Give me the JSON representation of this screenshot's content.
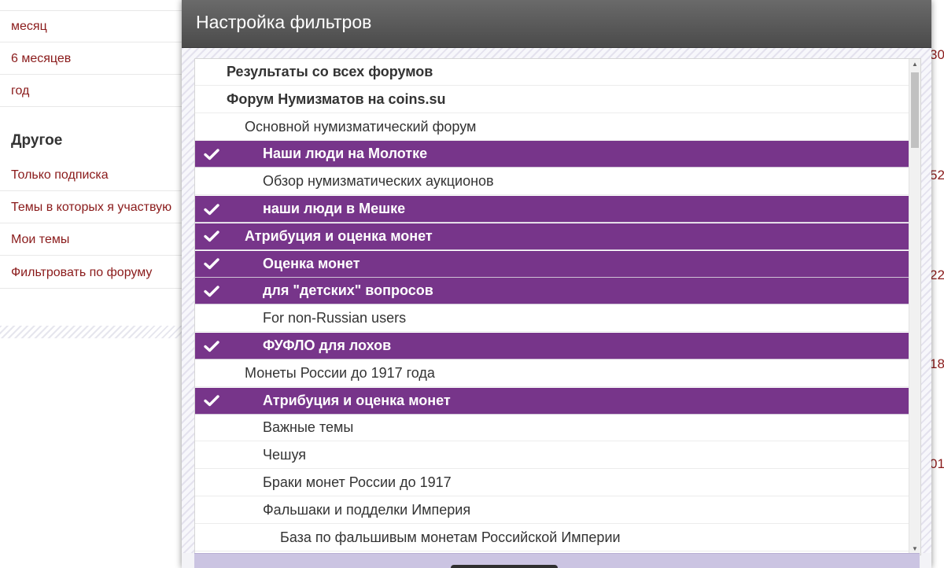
{
  "sidebar": {
    "items": [
      {
        "label": "месяц"
      },
      {
        "label": "6 месяцев"
      },
      {
        "label": "год"
      }
    ],
    "heading": "Другое",
    "other_items": [
      {
        "label": "Только подписка"
      },
      {
        "label": "Темы в которых я участвую"
      },
      {
        "label": "Мои темы"
      },
      {
        "label": "Фильтровать по форуму"
      }
    ]
  },
  "background_numbers": [
    "30",
    "52",
    "22",
    "18",
    "01"
  ],
  "modal": {
    "title": "Настройка фильтров",
    "items": [
      {
        "label": "Результаты со всех форумов",
        "level": 0,
        "selected": false,
        "bold": true
      },
      {
        "label": "Форум Нумизматов на coins.su",
        "level": 0,
        "selected": false,
        "bold": true
      },
      {
        "label": "Основной нумизматический форум",
        "level": 1,
        "selected": false,
        "bold": false
      },
      {
        "label": "Наши люди на Молотке",
        "level": 2,
        "selected": true,
        "bold": true
      },
      {
        "label": "Обзор нумизматических аукционов",
        "level": 2,
        "selected": false,
        "bold": false
      },
      {
        "label": "наши люди в Мешке",
        "level": 2,
        "selected": true,
        "bold": true
      },
      {
        "label": "Атрибуция и оценка монет",
        "level": 1,
        "selected": true,
        "bold": true
      },
      {
        "label": "Оценка монет",
        "level": 2,
        "selected": true,
        "bold": true
      },
      {
        "label": "для \"детских\" вопросов",
        "level": 2,
        "selected": true,
        "bold": true
      },
      {
        "label": "For non-Russian users",
        "level": 2,
        "selected": false,
        "bold": false
      },
      {
        "label": "ФУФЛО для лохов",
        "level": 2,
        "selected": true,
        "bold": true
      },
      {
        "label": "Монеты России до 1917 года",
        "level": 1,
        "selected": false,
        "bold": false
      },
      {
        "label": "Атрибуция и оценка монет",
        "level": 2,
        "selected": true,
        "bold": true
      },
      {
        "label": "Важные темы",
        "level": 2,
        "selected": false,
        "bold": false
      },
      {
        "label": "Чешуя",
        "level": 2,
        "selected": false,
        "bold": false
      },
      {
        "label": "Браки монет России до 1917",
        "level": 2,
        "selected": false,
        "bold": false
      },
      {
        "label": "Фальшаки и подделки Империя",
        "level": 2,
        "selected": false,
        "bold": false
      },
      {
        "label": "База по фальшивым монетам Российской Империи",
        "level": 3,
        "selected": false,
        "bold": false
      }
    ]
  },
  "icons": {
    "check": "checkmark-icon",
    "scroll_up": "triangle-up-icon",
    "scroll_down": "triangle-down-icon"
  },
  "colors": {
    "selected_row": "#77358a",
    "link": "#8a1a1a",
    "header": "#555555",
    "footer": "#cbc4e2"
  }
}
